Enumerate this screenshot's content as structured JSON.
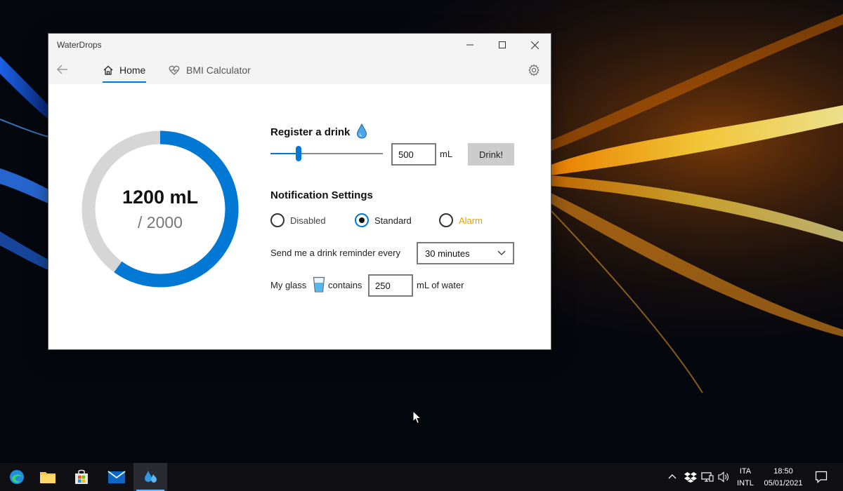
{
  "window": {
    "title": "WaterDrops"
  },
  "nav": {
    "home_label": "Home",
    "bmi_label": "BMI Calculator"
  },
  "progress": {
    "value_text": "1200 mL",
    "goal_text": "/ 2000",
    "fraction": 0.6
  },
  "drink": {
    "heading": "Register a drink",
    "amount": "500",
    "unit": "mL",
    "button_label": "Drink!",
    "slider_fraction": 0.25
  },
  "notifications": {
    "heading": "Notification Settings",
    "options": [
      "Disabled",
      "Standard",
      "Alarm"
    ],
    "selected": "Standard",
    "alarm_color": "#e8a100",
    "reminder_label": "Send me a drink reminder every",
    "reminder_value": "30 minutes",
    "glass_label_before": "My glass",
    "glass_label_middle": "contains",
    "glass_amount": "250",
    "glass_label_after": "mL of water"
  },
  "colors": {
    "accent": "#0078d4",
    "ring_track": "#d6d6d6"
  },
  "taskbar": {
    "language": "ITA",
    "layout": "INTL",
    "time": "18:50",
    "date": "05/01/2021"
  }
}
